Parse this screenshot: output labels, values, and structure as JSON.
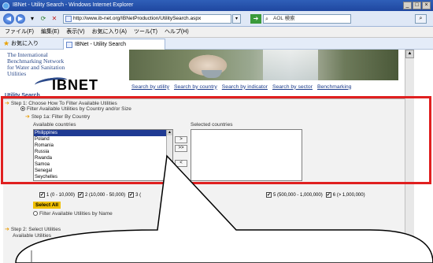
{
  "window": {
    "title": "IBNet - Utility Search - Windows Internet Explorer",
    "controls": [
      "_",
      "□",
      "×"
    ]
  },
  "address_bar": {
    "url": "http://www.ib-net.org/IBNetProduction/UtilitySearch.aspx",
    "search_placeholder": "AOL 検索"
  },
  "menu": {
    "items": [
      "ファイル(F)",
      "編集(E)",
      "表示(V)",
      "お気に入り(A)",
      "ツール(T)",
      "ヘルプ(H)"
    ]
  },
  "favorites": {
    "label": "お気に入り",
    "tab_title": "IBNet - Utility Search"
  },
  "site": {
    "logo_lines": [
      "The International",
      "Benchmarking Network",
      "for Water and Sanitation",
      "Utilities"
    ],
    "logo_mark": "IBNET",
    "nav_links": [
      "Search by utility",
      "Search by country",
      "Search by indicator",
      "Search by sector",
      "Benchmarking"
    ],
    "heading": "Utility Search"
  },
  "step1": {
    "title": "Step 1: Choose How To Filter Available Utilities",
    "option_country_size": "Filter Available Utilities by Country and/or Size",
    "sub_step": "Step 1a: Filter By Country",
    "available_label": "Available countries",
    "selected_label": "Selected countries",
    "available_countries": [
      "Philippines",
      "Poland",
      "Romania",
      "Russia",
      "Rwanda",
      "Samoa",
      "Senegal",
      "Seychelles"
    ],
    "selected_country": "Philippines",
    "move_buttons": [
      ">",
      ">>",
      "<"
    ],
    "size_filters": [
      "1 (0 - 10,000)",
      "2 (10,000 - 50,000)",
      "3 (",
      "5 (500,000 - 1,000,000)",
      "6 (> 1,000,000)"
    ],
    "select_all": "Select All",
    "option_name": "Filter Available Utilities by Name"
  },
  "step2": {
    "title": "Step 2: Select Utilities",
    "available_label": "Available Utilities"
  },
  "colors": {
    "highlight": "#e02020",
    "titlebar": "#2f5fb8",
    "link": "#1a3a8a",
    "selection": "#1f3a93",
    "select_all_bg": "#f0c000"
  },
  "icons": [
    "ie-logo-icon",
    "back-icon",
    "forward-icon",
    "refresh-icon",
    "stop-icon",
    "favicon-icon",
    "go-icon",
    "search-icon",
    "favorites-star-icon",
    "tab-icon",
    "step-arrow-icon",
    "scroll-up-icon"
  ]
}
